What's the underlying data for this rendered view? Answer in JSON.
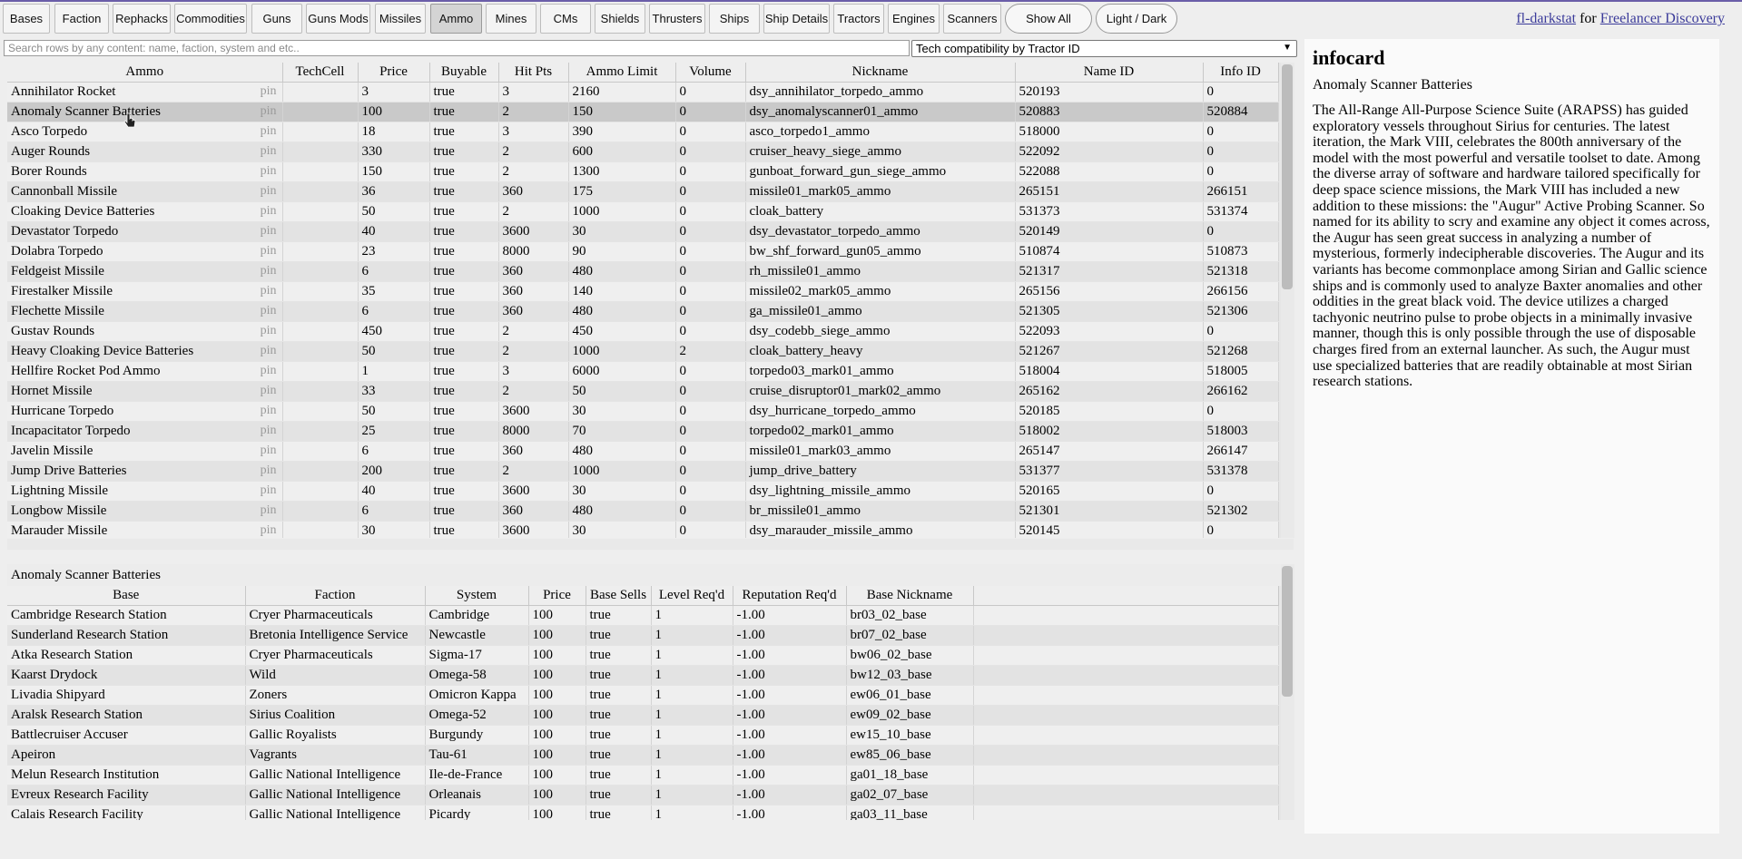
{
  "nav": {
    "tabs": [
      "Bases",
      "Faction",
      "Rephacks",
      "Commodities",
      "Guns",
      "Guns Mods",
      "Missiles",
      "Ammo",
      "Mines",
      "CMs",
      "Shields",
      "Thrusters",
      "Ships",
      "Ship Details",
      "Tractors",
      "Engines",
      "Scanners"
    ],
    "active": "Ammo",
    "show_all": "Show All",
    "light_dark": "Light / Dark"
  },
  "credit": {
    "app": "fl-darkstat",
    "for": " for ",
    "project": "Freelancer Discovery"
  },
  "search": {
    "placeholder": "Search rows by any content: name, faction, system and etc.."
  },
  "filter": {
    "selected": "Tech compatibility by Tractor ID"
  },
  "ammo_table": {
    "headers": [
      "Ammo",
      "TechCell",
      "Price",
      "Buyable",
      "Hit Pts",
      "Ammo Limit",
      "Volume",
      "Nickname",
      "Name ID",
      "Info ID"
    ],
    "pin_label": "pin",
    "selected_index": 1,
    "rows": [
      [
        "Annihilator Rocket",
        "",
        "3",
        "true",
        "3",
        "2160",
        "0",
        "dsy_annihilator_torpedo_ammo",
        "520193",
        "0"
      ],
      [
        "Anomaly Scanner Batteries",
        "",
        "100",
        "true",
        "2",
        "150",
        "0",
        "dsy_anomalyscanner01_ammo",
        "520883",
        "520884"
      ],
      [
        "Asco Torpedo",
        "",
        "18",
        "true",
        "3",
        "390",
        "0",
        "asco_torpedo1_ammo",
        "518000",
        "0"
      ],
      [
        "Auger Rounds",
        "",
        "330",
        "true",
        "2",
        "600",
        "0",
        "cruiser_heavy_siege_ammo",
        "522092",
        "0"
      ],
      [
        "Borer Rounds",
        "",
        "150",
        "true",
        "2",
        "1300",
        "0",
        "gunboat_forward_gun_siege_ammo",
        "522088",
        "0"
      ],
      [
        "Cannonball Missile",
        "",
        "36",
        "true",
        "360",
        "175",
        "0",
        "missile01_mark05_ammo",
        "265151",
        "266151"
      ],
      [
        "Cloaking Device Batteries",
        "",
        "50",
        "true",
        "2",
        "1000",
        "0",
        "cloak_battery",
        "531373",
        "531374"
      ],
      [
        "Devastator Torpedo",
        "",
        "40",
        "true",
        "3600",
        "30",
        "0",
        "dsy_devastator_torpedo_ammo",
        "520149",
        "0"
      ],
      [
        "Dolabra Torpedo",
        "",
        "23",
        "true",
        "8000",
        "90",
        "0",
        "bw_shf_forward_gun05_ammo",
        "510874",
        "510873"
      ],
      [
        "Feldgeist Missile",
        "",
        "6",
        "true",
        "360",
        "480",
        "0",
        "rh_missile01_ammo",
        "521317",
        "521318"
      ],
      [
        "Firestalker Missile",
        "",
        "35",
        "true",
        "360",
        "140",
        "0",
        "missile02_mark05_ammo",
        "265156",
        "266156"
      ],
      [
        "Flechette Missile",
        "",
        "6",
        "true",
        "360",
        "480",
        "0",
        "ga_missile01_ammo",
        "521305",
        "521306"
      ],
      [
        "Gustav Rounds",
        "",
        "450",
        "true",
        "2",
        "450",
        "0",
        "dsy_codebb_siege_ammo",
        "522093",
        "0"
      ],
      [
        "Heavy Cloaking Device Batteries",
        "",
        "50",
        "true",
        "2",
        "1000",
        "2",
        "cloak_battery_heavy",
        "521267",
        "521268"
      ],
      [
        "Hellfire Rocket Pod Ammo",
        "",
        "1",
        "true",
        "3",
        "6000",
        "0",
        "torpedo03_mark01_ammo",
        "518004",
        "518005"
      ],
      [
        "Hornet Missile",
        "",
        "33",
        "true",
        "2",
        "50",
        "0",
        "cruise_disruptor01_mark02_ammo",
        "265162",
        "266162"
      ],
      [
        "Hurricane Torpedo",
        "",
        "50",
        "true",
        "3600",
        "30",
        "0",
        "dsy_hurricane_torpedo_ammo",
        "520185",
        "0"
      ],
      [
        "Incapacitator Torpedo",
        "",
        "25",
        "true",
        "8000",
        "70",
        "0",
        "torpedo02_mark01_ammo",
        "518002",
        "518003"
      ],
      [
        "Javelin Missile",
        "",
        "6",
        "true",
        "360",
        "480",
        "0",
        "missile01_mark03_ammo",
        "265147",
        "266147"
      ],
      [
        "Jump Drive Batteries",
        "",
        "200",
        "true",
        "2",
        "1000",
        "0",
        "jump_drive_battery",
        "531377",
        "531378"
      ],
      [
        "Lightning Missile",
        "",
        "40",
        "true",
        "3600",
        "30",
        "0",
        "dsy_lightning_missile_ammo",
        "520165",
        "0"
      ],
      [
        "Longbow Missile",
        "",
        "6",
        "true",
        "360",
        "480",
        "0",
        "br_missile01_ammo",
        "521301",
        "521302"
      ],
      [
        "Marauder Missile",
        "",
        "30",
        "true",
        "3600",
        "30",
        "0",
        "dsy_marauder_missile_ammo",
        "520145",
        "0"
      ]
    ]
  },
  "bases_table": {
    "caption": "Anomaly Scanner Batteries",
    "headers": [
      "Base",
      "Faction",
      "System",
      "Price",
      "Base Sells",
      "Level Req'd",
      "Reputation Req'd",
      "Base Nickname"
    ],
    "rows": [
      [
        "Cambridge Research Station",
        "Cryer Pharmaceuticals",
        "Cambridge",
        "100",
        "true",
        "1",
        "-1.00",
        "br03_02_base"
      ],
      [
        "Sunderland Research Station",
        "Bretonia Intelligence Service",
        "Newcastle",
        "100",
        "true",
        "1",
        "-1.00",
        "br07_02_base"
      ],
      [
        "Atka Research Station",
        "Cryer Pharmaceuticals",
        "Sigma-17",
        "100",
        "true",
        "1",
        "-1.00",
        "bw06_02_base"
      ],
      [
        "Kaarst Drydock",
        "Wild",
        "Omega-58",
        "100",
        "true",
        "1",
        "-1.00",
        "bw12_03_base"
      ],
      [
        "Livadia Shipyard",
        "Zoners",
        "Omicron Kappa",
        "100",
        "true",
        "1",
        "-1.00",
        "ew06_01_base"
      ],
      [
        "Aralsk Research Station",
        "Sirius Coalition",
        "Omega-52",
        "100",
        "true",
        "1",
        "-1.00",
        "ew09_02_base"
      ],
      [
        "Battlecruiser Accuser",
        "Gallic Royalists",
        "Burgundy",
        "100",
        "true",
        "1",
        "-1.00",
        "ew15_10_base"
      ],
      [
        "Apeiron",
        "Vagrants",
        "Tau-61",
        "100",
        "true",
        "1",
        "-1.00",
        "ew85_06_base"
      ],
      [
        "Melun Research Institution",
        "Gallic National Intelligence",
        "Ile-de-France",
        "100",
        "true",
        "1",
        "-1.00",
        "ga01_18_base"
      ],
      [
        "Evreux Research Facility",
        "Gallic National Intelligence",
        "Orleanais",
        "100",
        "true",
        "1",
        "-1.00",
        "ga02_07_base"
      ],
      [
        "Calais Research Facility",
        "Gallic National Intelligence",
        "Picardy",
        "100",
        "true",
        "1",
        "-1.00",
        "ga03_11_base"
      ]
    ]
  },
  "infocard": {
    "title": "infocard",
    "name": "Anomaly Scanner Batteries",
    "body": "The All-Range All-Purpose Science Suite (ARAPSS) has guided exploratory vessels throughout Sirius for centuries. The latest iteration, the Mark VIII, celebrates the 800th anniversary of the model with the most powerful and versatile toolset to date. Among the diverse array of software and hardware tailored specifically for deep space science missions, the Mark VIII has included a new addition to these missions: the \"Augur\" Active Probing Scanner. So named for its ability to scry and examine any object it comes across, the Augur has seen great success in analyzing a number of mysterious, formerly indecipherable discoveries. The Augur and its variants has become commonplace among Sirian and Gallic science ships and is commonly used to analyze Baxter anomalies and other oddities in the great black void. The device utilizes a charged tachyonic neutrino pulse to probe objects in a minimally invasive manner, though this is only possible through the use of disposable charges fired from an external launcher. As such, the Augur must use specialized batteries that are readily obtainable at most Sirian research stations."
  }
}
